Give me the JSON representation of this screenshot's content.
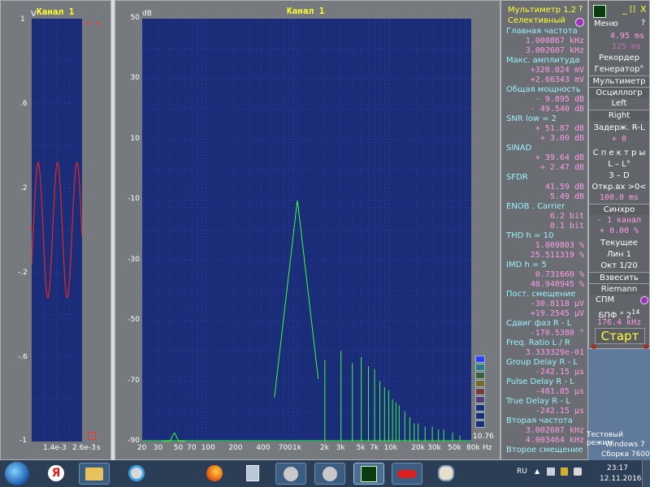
{
  "osc": {
    "title": "Канал 1",
    "unit_v": "V",
    "ch_marker": "Ч - Ч",
    "yticks": [
      "1",
      ".6",
      ".2",
      "-.2",
      "-.6",
      "-1"
    ],
    "xticks": [
      "1.4e-3",
      "2.6e-3",
      "s"
    ]
  },
  "spec": {
    "title": "Канал 1",
    "unit_db": "dB",
    "yticks": [
      "50",
      "30",
      "10",
      "-10",
      "-30",
      "-50",
      "-70",
      "-90"
    ],
    "xticks": [
      "20",
      "30",
      "50",
      "70",
      "100",
      "200",
      "400",
      "700",
      "1k",
      "2k",
      "3k",
      "5k",
      "7k",
      "10k",
      "20k",
      "30k",
      "50k",
      "80k",
      "Hz"
    ],
    "cursor_value": "10.76"
  },
  "multimeter": {
    "header": "Мультиметр 1,2",
    "help": "?",
    "mode": "Селективный",
    "rows": [
      {
        "t": "h",
        "text": "Главная частота"
      },
      {
        "t": "v",
        "text": "1.000867 kHz"
      },
      {
        "t": "v",
        "text": "3.002607 kHz"
      },
      {
        "t": "h",
        "text": "Макс. амплитуда"
      },
      {
        "t": "v",
        "text": "+320.024 mV"
      },
      {
        "t": "v",
        "text": "+2.66343 mV"
      },
      {
        "t": "h",
        "text": "Общая мощность"
      },
      {
        "t": "v",
        "text": "-  9.895 dB"
      },
      {
        "t": "v",
        "text": "- 49.540 dB"
      },
      {
        "t": "h",
        "text": "SNR     low =     2"
      },
      {
        "t": "v",
        "text": "+ 51.87 dB"
      },
      {
        "t": "v",
        "text": "+  3.00 dB"
      },
      {
        "t": "h",
        "text": "SINAD"
      },
      {
        "t": "v",
        "text": "+ 39.64 dB"
      },
      {
        "t": "v",
        "text": "+  2.47 dB"
      },
      {
        "t": "h",
        "text": "SFDR"
      },
      {
        "t": "v",
        "text": "41.59 dB"
      },
      {
        "t": "v",
        "text": "5.49 dB"
      },
      {
        "t": "h",
        "text": "ENOB . Carrier"
      },
      {
        "t": "v",
        "text": "6.2 bit"
      },
      {
        "t": "v",
        "text": "0.1 bit"
      },
      {
        "t": "h",
        "text": "THD      h =    10"
      },
      {
        "t": "v",
        "text": "1.009803 %"
      },
      {
        "t": "v",
        "text": "25.511319 %"
      },
      {
        "t": "h",
        "text": "IMD      h =     5"
      },
      {
        "t": "v",
        "text": "0.731660 %"
      },
      {
        "t": "v",
        "text": "40.940945 %"
      },
      {
        "t": "h",
        "text": "Пост. смещение"
      },
      {
        "t": "v",
        "text": "-30.8118 µV"
      },
      {
        "t": "v",
        "text": "+19.2545 µV"
      },
      {
        "t": "h",
        "text": "Сдвиг фаз R - L"
      },
      {
        "t": "v",
        "text": "-170.5380 °"
      },
      {
        "t": "h",
        "text": "Freq. Ratio  L / R"
      },
      {
        "t": "v",
        "text": "3.333329e-01"
      },
      {
        "t": "h",
        "text": "Group Delay R - L"
      },
      {
        "t": "v",
        "text": "-242.15 µs"
      },
      {
        "t": "h",
        "text": "Pulse Delay R - L"
      },
      {
        "t": "v",
        "text": "-481.85 µs"
      },
      {
        "t": "h",
        "text": "True Delay R - L"
      },
      {
        "t": "v",
        "text": "-242.15 µs"
      },
      {
        "t": "h",
        "text": "Вторая частота"
      },
      {
        "t": "v",
        "text": "3.002607 kHz"
      },
      {
        "t": "v",
        "text": "4.003464 kHz"
      },
      {
        "t": "h",
        "text": "Второе смещение"
      }
    ]
  },
  "control": {
    "top_buttons": [
      "_",
      "[]",
      "X"
    ],
    "menu": "Меню",
    "help": "?",
    "time1": "4.95 ms",
    "time2": "125 ms",
    "recorder": "Рекордер",
    "generator": "Генератор°",
    "multimeter": "Мультиметр",
    "oscillograph": "Осциллогр",
    "left": "Left",
    "right": "Right",
    "delay": "Задерж. R-L",
    "delay_val": "+       0",
    "spectra": "С п е к т р ы",
    "lr": "L – L°",
    "three_d": "3 – D",
    "open_in": "Откр.вх >0<",
    "open_val": "100.0 ms",
    "sync": "Синхро",
    "sync_ch": "- 1 канал",
    "sync_pct": "+  0.00 %",
    "current": "Текущее",
    "lin": "Лин         1",
    "oct": "Окт    1/20",
    "weigh": "Взвесить",
    "riemann": "Riemann",
    "spm": "СПМ",
    "bpf_label": "БПФ ° 2",
    "bpf_exp": "14",
    "bpf_freq": "176.4 kHz",
    "start": "Старт"
  },
  "desktop": {
    "line1": "Тестовый режим",
    "line2": "Windows 7",
    "line3": "Сборка 7600"
  },
  "taskbar": {
    "lang": "RU",
    "time": "23:17",
    "date": "12.11.2016"
  },
  "colors": {
    "plot_bg": "#1b2d78",
    "grid": "#3d5bd0",
    "wave": "#e02828",
    "spectrum": "#39ff39",
    "accent": "#ffff30"
  }
}
